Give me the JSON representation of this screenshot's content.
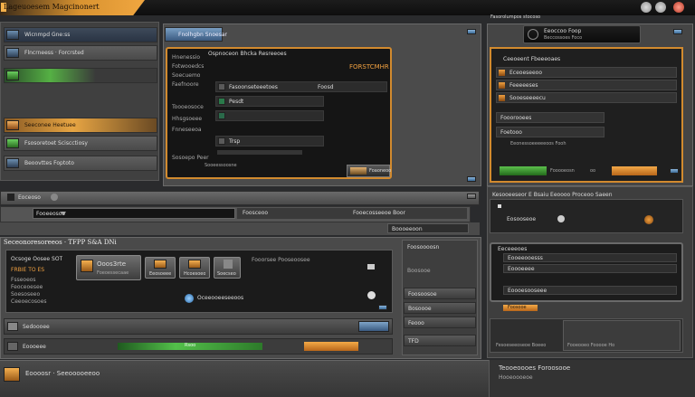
{
  "window": {
    "title": "Lageuoesem Magcinonert",
    "right_title": "Fasorolumpos stocoso"
  },
  "left_panel": {
    "items": [
      {
        "label": "Wicnmpd  Gne:ss"
      },
      {
        "label": "Flncrneess  ·  Forcrsted"
      },
      {
        "label": ""
      },
      {
        "label": "Seeconee Heetuee"
      },
      {
        "label": "Fsosoretoet  Sciscctiosy"
      },
      {
        "label": "Beoovttes  Foptoto"
      }
    ]
  },
  "center": {
    "header_label": "Fnolhgbn Snoesar",
    "dialog_title": "Ospnoceon Bhcka Resreeoes",
    "dialog_badge": "FORSTCMHR",
    "left_labels": [
      "Hnenessio",
      "Fotwooedcs",
      "Soecuemo",
      "Faefnoore",
      "Toooeosoce",
      "Hhsgsoeee",
      "Fnneseeoa",
      "Sosoepo Peer"
    ],
    "rows": [
      {
        "label": "Fasoonseteeetoes",
        "icon_letter": "F",
        "right": "Foosd"
      },
      {
        "label": "Pesdt",
        "icon_letter": "B",
        "right": ""
      },
      {
        "label": "Trsp",
        "icon_letter": "C",
        "right": ""
      }
    ],
    "progress_label": "Sooeessoosne",
    "thumb_label": "Foaoneoo"
  },
  "right_panel": {
    "header_label": "Eeoccoo  Foop",
    "header_sub": "Beccossoes  Foco",
    "title": "Ceeoeent  Fbeeeoaes",
    "rows": [
      "Eceoeseeoo",
      "Feeeeeses",
      "Sooeseeeecu",
      "Fooorooees",
      "Foetooo"
    ],
    "footer_left": "Eeonessoeeeeeoos  Fooh",
    "footer_right": "Fooooeosn",
    "footer_dots": "oo"
  },
  "toolbar": {
    "label": "Eoceoso",
    "address_value": "Fooeeosoo",
    "address_right": "Foosceoo",
    "address_far": "Fooecosseeoe  Boor",
    "sub_field": "Boooeeoon"
  },
  "bottom": {
    "heading": "Seceonoresoreeos  ·  TFPP  S&A  DNi",
    "dialog_line1": "Ocsoge  Oosee  SOT",
    "dialog_line2": "FRBIE  TO  ES",
    "dialog_labels": [
      "Fsseoeos",
      "Feoceoesee",
      "Soesoseeo",
      "Ceeoecosoes"
    ],
    "big_button_title": "Ooos3rte",
    "big_button_sub": "Foeoessecaae",
    "button_labels": [
      "Eeosoeee",
      "Hcoesoeo",
      "Soecseo"
    ],
    "right_text": "Fooorsee  Pooseoosee",
    "globe_label": "Oceeooeeseeoos",
    "side_items": [
      "Foosoooosn",
      "Boosooe",
      "Foosoosoe",
      "Bosoooe",
      "Feooo",
      "TFD"
    ],
    "row1_label": "Sedoooee",
    "row2_label": "Eoooeee",
    "green_bar_label": "Rsoo"
  },
  "right_lower": {
    "title": "Kesooeeseor  E  Bsaiu  Eeoooo  Proceoo  Saeen",
    "panel1_label": "Eosooseoe",
    "panel2_title": "Eeceeeoes",
    "rows": [
      "Eooeeooesss",
      "Eoooeeee",
      "Eoooesooseee"
    ],
    "orange_label": "Foosooe",
    "panel3_left": "Fesoeseeoseoe  Boeeo",
    "panel3_right": "Fooeooeo  Fooooe  Ho"
  },
  "statusbar": {
    "left_text": "Eoooosr  ·  Seeooooeeoo",
    "right_line1": "Teooeoooes  Foroosooe",
    "right_line2": "Hooeoooeoe"
  }
}
